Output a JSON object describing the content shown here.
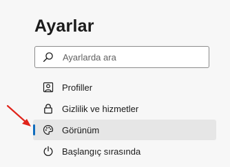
{
  "settings": {
    "title": "Ayarlar",
    "search": {
      "placeholder": "Ayarlarda ara",
      "icon": "search-icon"
    },
    "nav": {
      "items": [
        {
          "label": "Profiller",
          "icon": "profile-icon",
          "active": false
        },
        {
          "label": "Gizlilik ve hizmetler",
          "icon": "lock-icon",
          "active": false
        },
        {
          "label": "Görünüm",
          "icon": "palette-icon",
          "active": true
        },
        {
          "label": "Başlangıç sırasında",
          "icon": "power-icon",
          "active": false
        }
      ]
    },
    "colors": {
      "accent": "#0f6cbd",
      "active_background": "#e6e6e6",
      "annotation_arrow": "#e0241b"
    }
  }
}
